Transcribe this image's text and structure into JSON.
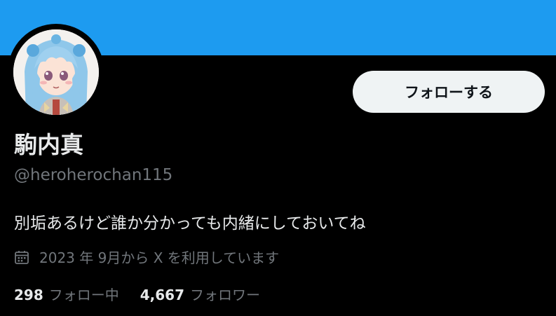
{
  "profile": {
    "display_name": "駒内真",
    "handle": "@heroherochan115",
    "bio": "別垢あるけど誰か分かっても内緒にしておいてね",
    "joined": "2023 年 9月から X を利用しています",
    "follow_button_label": "フォローする",
    "banner_color": "#1d9bf0",
    "avatar_icon": "anime-character-avatar",
    "calendar_icon": "calendar-icon"
  },
  "stats": {
    "following_count": "298",
    "following_label": "フォロー中",
    "followers_count": "4,667",
    "followers_label": "フォロワー"
  }
}
